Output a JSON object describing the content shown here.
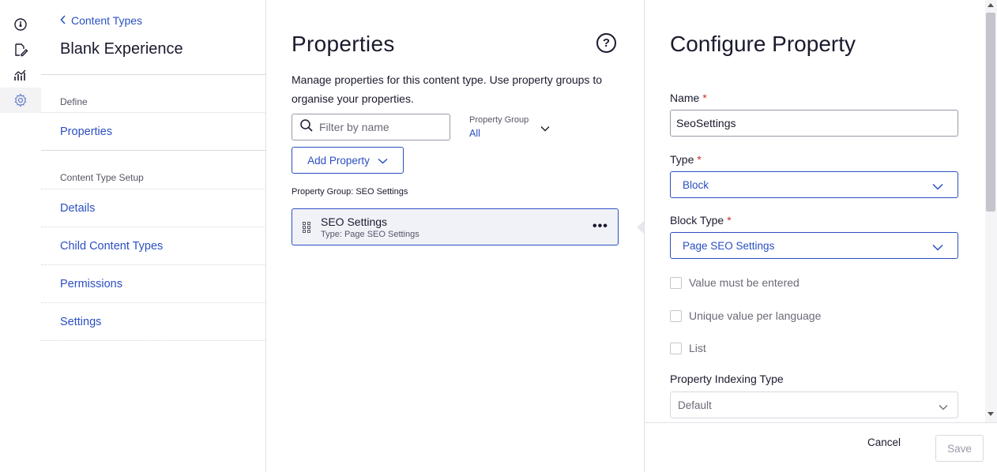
{
  "rail": {
    "items": [
      {
        "icon": "dashboard-gauge-icon"
      },
      {
        "icon": "edit-content-icon"
      },
      {
        "icon": "analytics-icon"
      },
      {
        "icon": "settings-gear-icon",
        "active": true
      }
    ]
  },
  "nav": {
    "back_label": "Content Types",
    "title": "Blank Experience",
    "section_define": "Define",
    "properties_link": "Properties",
    "section_setup": "Content Type Setup",
    "links": [
      "Details",
      "Child Content Types",
      "Permissions",
      "Settings"
    ]
  },
  "properties": {
    "title": "Properties",
    "help_label": "?",
    "description": "Manage properties for this content type. Use property groups to organise your properties.",
    "filter_placeholder": "Filter by name",
    "group_filter_label": "Property Group",
    "group_filter_value": "All",
    "add_button": "Add Property",
    "group_heading": "Property Group: SEO Settings",
    "items": [
      {
        "name": "SEO Settings",
        "type": "Type: Page SEO Settings",
        "more": "•••"
      }
    ]
  },
  "config": {
    "title": "Configure Property",
    "name_label": "Name",
    "name_value": "SeoSettings",
    "type_label": "Type",
    "type_value": "Block",
    "block_type_label": "Block Type",
    "block_type_value": "Page SEO Settings",
    "required_mark": "*",
    "checkboxes": [
      "Value must be entered",
      "Unique value per language",
      "List"
    ],
    "indexing_label": "Property Indexing Type",
    "indexing_value": "Default",
    "cancel": "Cancel",
    "save": "Save"
  },
  "colors": {
    "accent": "#2b4fc2",
    "required": "#d12b2b",
    "text": "#1a1a2e"
  }
}
